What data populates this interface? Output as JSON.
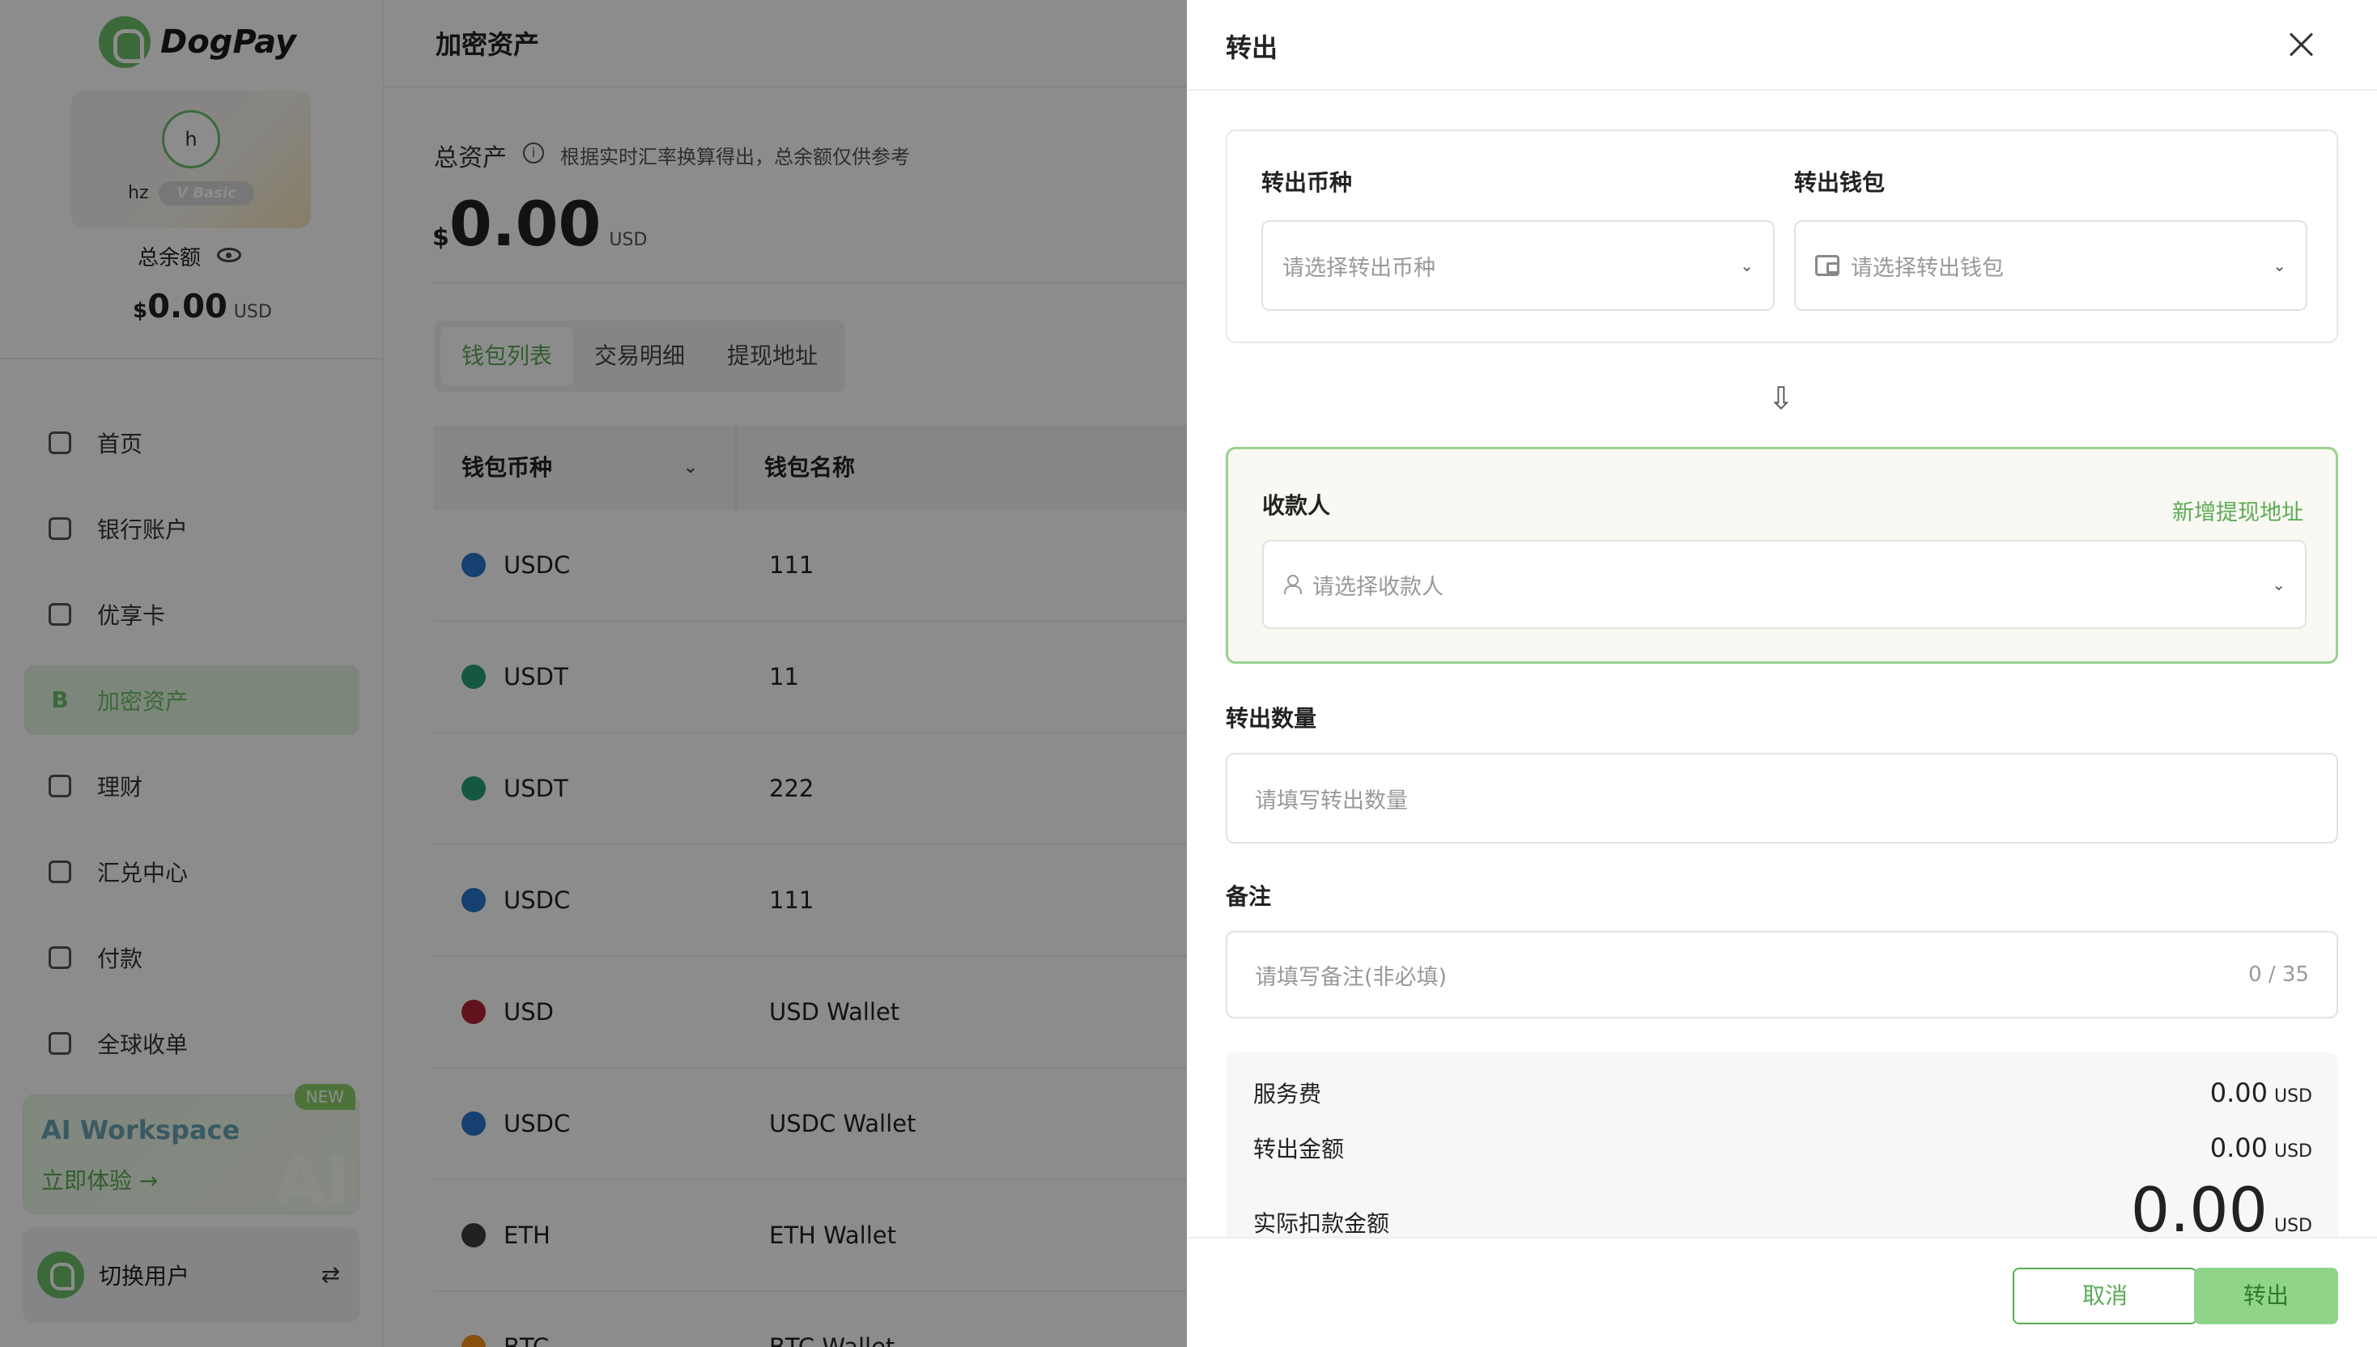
{
  "app": {
    "brand": "DogPay",
    "user_initial": "h",
    "user_name": "hz",
    "vip_label": "V Basic",
    "balance_label": "总余额",
    "balance_currency": "$",
    "balance_value": "0.00",
    "balance_unit": "USD",
    "accent_color": "#6cc06a"
  },
  "sidebar": {
    "items": [
      {
        "label": "首页",
        "icon": "home-icon"
      },
      {
        "label": "银行账户",
        "icon": "bank-icon"
      },
      {
        "label": "优享卡",
        "icon": "card-icon"
      },
      {
        "label": "加密资产",
        "icon": "crypto-b-icon",
        "glyph": "B",
        "active": true
      },
      {
        "label": "理财",
        "icon": "finance-icon"
      },
      {
        "label": "汇兑中心",
        "icon": "exchange-icon"
      },
      {
        "label": "付款",
        "icon": "payment-icon"
      },
      {
        "label": "全球收单",
        "icon": "acquiring-icon"
      }
    ],
    "ai_card": {
      "title": "AI Workspace",
      "cta": "立即体验 →",
      "badge": "NEW",
      "bg_text": "AI"
    },
    "switch_user": {
      "label": "切换用户",
      "icon": "swap-icon"
    }
  },
  "main": {
    "title": "加密资产",
    "total_label": "总资产",
    "total_note": "根据实时汇率换算得出，总余额仅供参考",
    "total_currency": "$",
    "total_value": "0.00",
    "total_unit": "USD",
    "tabs": [
      "钱包列表",
      "交易明细",
      "提现地址"
    ],
    "table": {
      "headers": [
        "钱包币种",
        "钱包名称"
      ],
      "rows": [
        {
          "coin": "USDC",
          "name": "111",
          "color": "#2775ca"
        },
        {
          "coin": "USDT",
          "name": "11",
          "color": "#26a17b"
        },
        {
          "coin": "USDT",
          "name": "222",
          "color": "#26a17b"
        },
        {
          "coin": "USDC",
          "name": "111",
          "color": "#2775ca"
        },
        {
          "coin": "USD",
          "name": "USD Wallet",
          "color": "#b22234"
        },
        {
          "coin": "USDC",
          "name": "USDC Wallet",
          "color": "#2775ca"
        },
        {
          "coin": "ETH",
          "name": "ETH Wallet",
          "color": "#3c3c3d"
        },
        {
          "coin": "BTC",
          "name": "BTC Wallet",
          "color": "#f7931a"
        }
      ]
    }
  },
  "drawer": {
    "title": "转出",
    "currency_label": "转出币种",
    "currency_placeholder": "请选择转出币种",
    "wallet_label": "转出钱包",
    "wallet_placeholder": "请选择转出钱包",
    "recipient_label": "收款人",
    "add_address_link": "新增提现地址",
    "recipient_placeholder": "请选择收款人",
    "amount_label": "转出数量",
    "amount_placeholder": "请填写转出数量",
    "note_label": "备注",
    "note_placeholder": "请填写备注(非必填)",
    "note_counter": "0 / 35",
    "summary": {
      "fee_label": "服务费",
      "fee_value": "0.00",
      "fee_unit": "USD",
      "out_label": "转出金额",
      "out_value": "0.00",
      "out_unit": "USD",
      "actual_label": "实际扣款金额",
      "actual_value": "0.00",
      "actual_unit": "USD"
    },
    "cancel_label": "取消",
    "submit_label": "转出"
  }
}
